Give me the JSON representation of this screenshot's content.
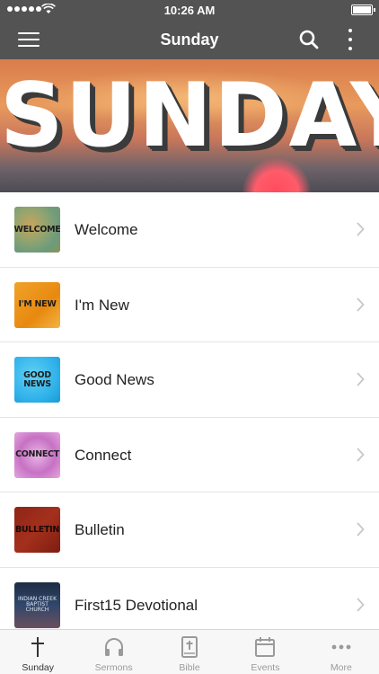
{
  "status_bar": {
    "time": "10:26 AM"
  },
  "nav": {
    "title": "Sunday"
  },
  "banner": {
    "text": "SUNDAY"
  },
  "list": [
    {
      "label": "Welcome",
      "thumb_text": "WELCOME"
    },
    {
      "label": "I'm New",
      "thumb_text": "I'M NEW"
    },
    {
      "label": "Good News",
      "thumb_text": "GOOD NEWS"
    },
    {
      "label": "Connect",
      "thumb_text": "CONNECT"
    },
    {
      "label": "Bulletin",
      "thumb_text": "BULLETIN"
    },
    {
      "label": "First15 Devotional",
      "thumb_text": "INDIAN CREEK BAPTIST CHURCH"
    }
  ],
  "tabs": [
    {
      "label": "Sunday",
      "icon": "cross-icon"
    },
    {
      "label": "Sermons",
      "icon": "headphones-icon"
    },
    {
      "label": "Bible",
      "icon": "bible-icon"
    },
    {
      "label": "Events",
      "icon": "calendar-icon"
    },
    {
      "label": "More",
      "icon": "more-dots-icon"
    }
  ],
  "colors": {
    "header_bg": "#535353",
    "active_tab": "#333333",
    "inactive_tab": "#9a9a9a"
  }
}
